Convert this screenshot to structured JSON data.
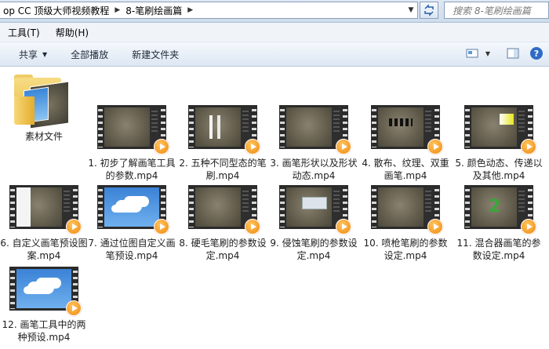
{
  "address": {
    "crumbs": [
      "op CC 顶级大师视频教程",
      "8-笔刷绘画篇"
    ],
    "search_placeholder": "搜索 8-笔刷绘画篇"
  },
  "menu": [
    "工具(T)",
    "帮助(H)"
  ],
  "toolbar": {
    "share": "共享",
    "play_all": "全部播放",
    "new_folder": "新建文件夹"
  },
  "items": [
    {
      "name": "素材文件",
      "kind": "folder"
    },
    {
      "name": "1. 初步了解画笔工具的参数.mp4",
      "kind": "video",
      "thumb": "panel"
    },
    {
      "name": "2. 五种不同型态的笔刷.mp4",
      "kind": "video",
      "thumb": "strokes"
    },
    {
      "name": "3. 画笔形状以及形状动态.mp4",
      "kind": "video",
      "thumb": "panel"
    },
    {
      "name": "4. 散布、纹理、双重画笔.mp4",
      "kind": "video",
      "thumb": "dots"
    },
    {
      "name": "5. 颜色动态、传递以及其他.mp4",
      "kind": "video",
      "thumb": "swatch"
    },
    {
      "name": "6. 自定义画笔预设图案.mp4",
      "kind": "video",
      "thumb": "window"
    },
    {
      "name": "7. 通过位图自定义画笔预设.mp4",
      "kind": "video",
      "thumb": "sky"
    },
    {
      "name": "8. 硬毛笔刷的参数设定.mp4",
      "kind": "video",
      "thumb": "panel"
    },
    {
      "name": "9. 侵蚀笔刷的参数设定.mp4",
      "kind": "video",
      "thumb": "dialog"
    },
    {
      "name": "10. 喷枪笔刷的参数设定.mp4",
      "kind": "video",
      "thumb": "panel"
    },
    {
      "name": "11. 混合器画笔的参数设定.mp4",
      "kind": "video",
      "thumb": "green"
    },
    {
      "name": "12. 画笔工具中的两种预设.mp4",
      "kind": "video",
      "thumb": "sky"
    }
  ],
  "colors": {
    "accent": "#f08a0c",
    "toolbar": "#dde7f3"
  }
}
